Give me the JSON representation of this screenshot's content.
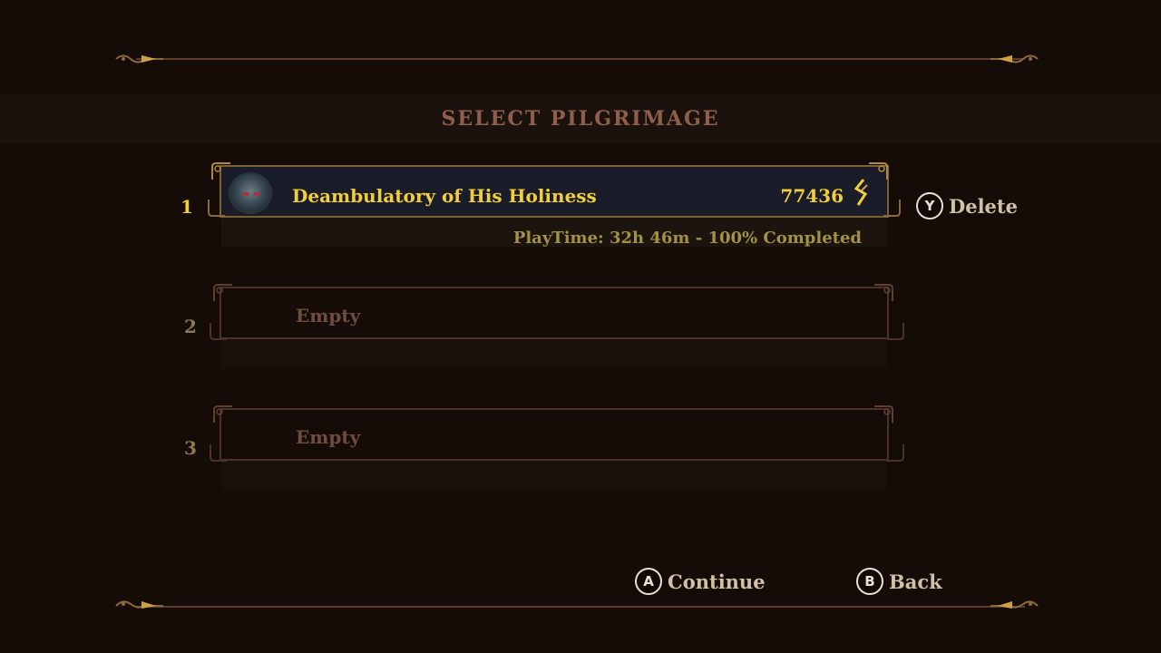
{
  "screen": {
    "title": "SELECT PILGRIMAGE"
  },
  "slots": [
    {
      "number": "1",
      "name": "Deambulatory of His Holiness",
      "tears": "77436",
      "play_info": "PlayTime: 32h 46m - 100% Completed",
      "portrait_icon": "penitent-portrait-icon",
      "currency_icon": "tears-of-atonement-icon"
    },
    {
      "number": "2",
      "label": "Empty"
    },
    {
      "number": "3",
      "label": "Empty"
    }
  ],
  "prompts": {
    "delete": {
      "button": "Y",
      "label": "Delete"
    },
    "continue": {
      "button": "A",
      "label": "Continue"
    },
    "back": {
      "button": "B",
      "label": "Back"
    }
  },
  "colors": {
    "selected_text": "#f2cf3a",
    "info_text": "#a39146",
    "empty_text": "#6e4c40",
    "title_text": "#8f5f4b",
    "background": "#150c08"
  }
}
